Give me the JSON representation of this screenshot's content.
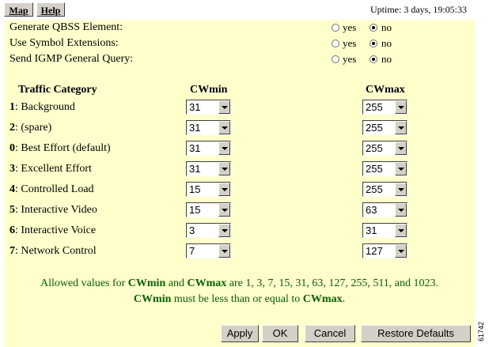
{
  "nav": {
    "map_label": "Map",
    "help_label": "Help"
  },
  "uptime": "Uptime: 3 days, 19:05:33",
  "options": [
    {
      "label": "Generate QBSS Element:",
      "yes": "yes",
      "no": "no",
      "selected": "no"
    },
    {
      "label": "Use Symbol Extensions:",
      "yes": "yes",
      "no": "no",
      "selected": "no"
    },
    {
      "label": "Send IGMP General Query:",
      "yes": "yes",
      "no": "no",
      "selected": "no"
    }
  ],
  "table": {
    "headers": {
      "category": "Traffic Category",
      "cwmin": "CWmin",
      "cwmax": "CWmax"
    },
    "rows": [
      {
        "num": "1",
        "name": ": Background",
        "cwmin": "31",
        "cwmax": "255"
      },
      {
        "num": "2",
        "name": ": (spare)",
        "cwmin": "31",
        "cwmax": "255"
      },
      {
        "num": "0",
        "name": ": Best Effort (default)",
        "cwmin": "31",
        "cwmax": "255"
      },
      {
        "num": "3",
        "name": ": Excellent Effort",
        "cwmin": "31",
        "cwmax": "255"
      },
      {
        "num": "4",
        "name": ": Controlled Load",
        "cwmin": "15",
        "cwmax": "255"
      },
      {
        "num": "5",
        "name": ": Interactive Video",
        "cwmin": "15",
        "cwmax": "63"
      },
      {
        "num": "6",
        "name": ": Interactive Voice",
        "cwmin": "3",
        "cwmax": "31"
      },
      {
        "num": "7",
        "name": ": Network Control",
        "cwmin": "7",
        "cwmax": "127"
      }
    ]
  },
  "note": {
    "line1_pre": "Allowed values for ",
    "cwmin": "CWmin",
    "and": " and ",
    "cwmax": "CWmax",
    "line1_post": " are 1, 3, 7, 15, 31, 63, 127, 255, 511, and 1023.",
    "line2_cwmin": "CWmin",
    "line2_mid": " must be less than or equal to ",
    "line2_cwmax": "CWmax",
    "line2_end": "."
  },
  "buttons": {
    "apply": "Apply",
    "ok": "OK",
    "cancel": "Cancel",
    "restore": "Restore Defaults"
  },
  "figure_id": "61742",
  "colors": {
    "panel_bg": "#ffffcc",
    "note_text": "#006600",
    "button_face": "#d4d0c8"
  }
}
